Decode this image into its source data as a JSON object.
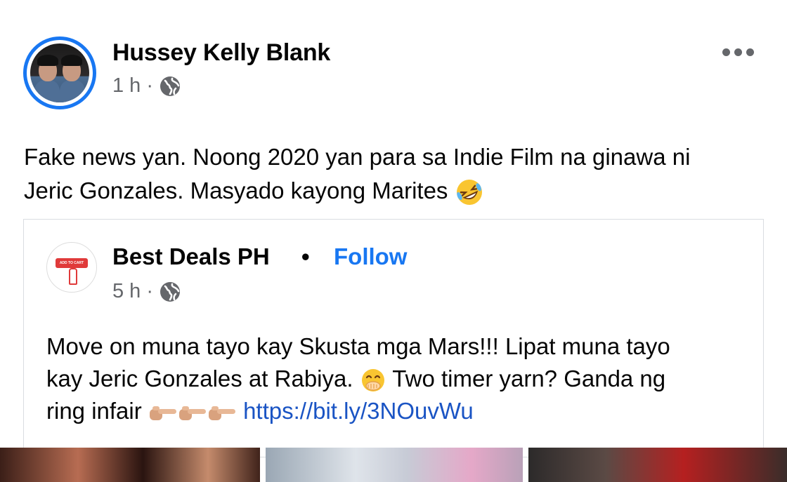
{
  "post": {
    "author": "Hussey Kelly Blank",
    "time": "1 h",
    "separator": "·",
    "text_line1": "Fake news yan. Noong 2020 yan para sa Indie Film na ginawa ni",
    "text_line2": "Jeric Gonzales. Masyado kayong Marites"
  },
  "shared": {
    "page_name": "Best Deals PH",
    "dot": "•",
    "follow_label": "Follow",
    "time": "5 h",
    "separator": "·",
    "logo_text": "ADD TO CART",
    "text_line1": "Move on muna tayo kay Skusta mga Mars!!! Lipat muna tayo",
    "text_line2a": "kay Jeric Gonzales at Rabiya.",
    "text_line2b": "Two timer yarn? Ganda ng",
    "text_line3": "ring infair",
    "link": "https://bit.ly/3NOuvWu"
  },
  "icons": {
    "more": "more-horizontal-icon",
    "globe": "globe-icon",
    "laugh": "rolling-laughing-emoji",
    "giggle": "giggling-emoji",
    "point": "pointing-right-emoji"
  },
  "colors": {
    "accent": "#1877f2",
    "link": "#1a54c4",
    "secondary_text": "#65676b",
    "border": "#dadde1"
  }
}
